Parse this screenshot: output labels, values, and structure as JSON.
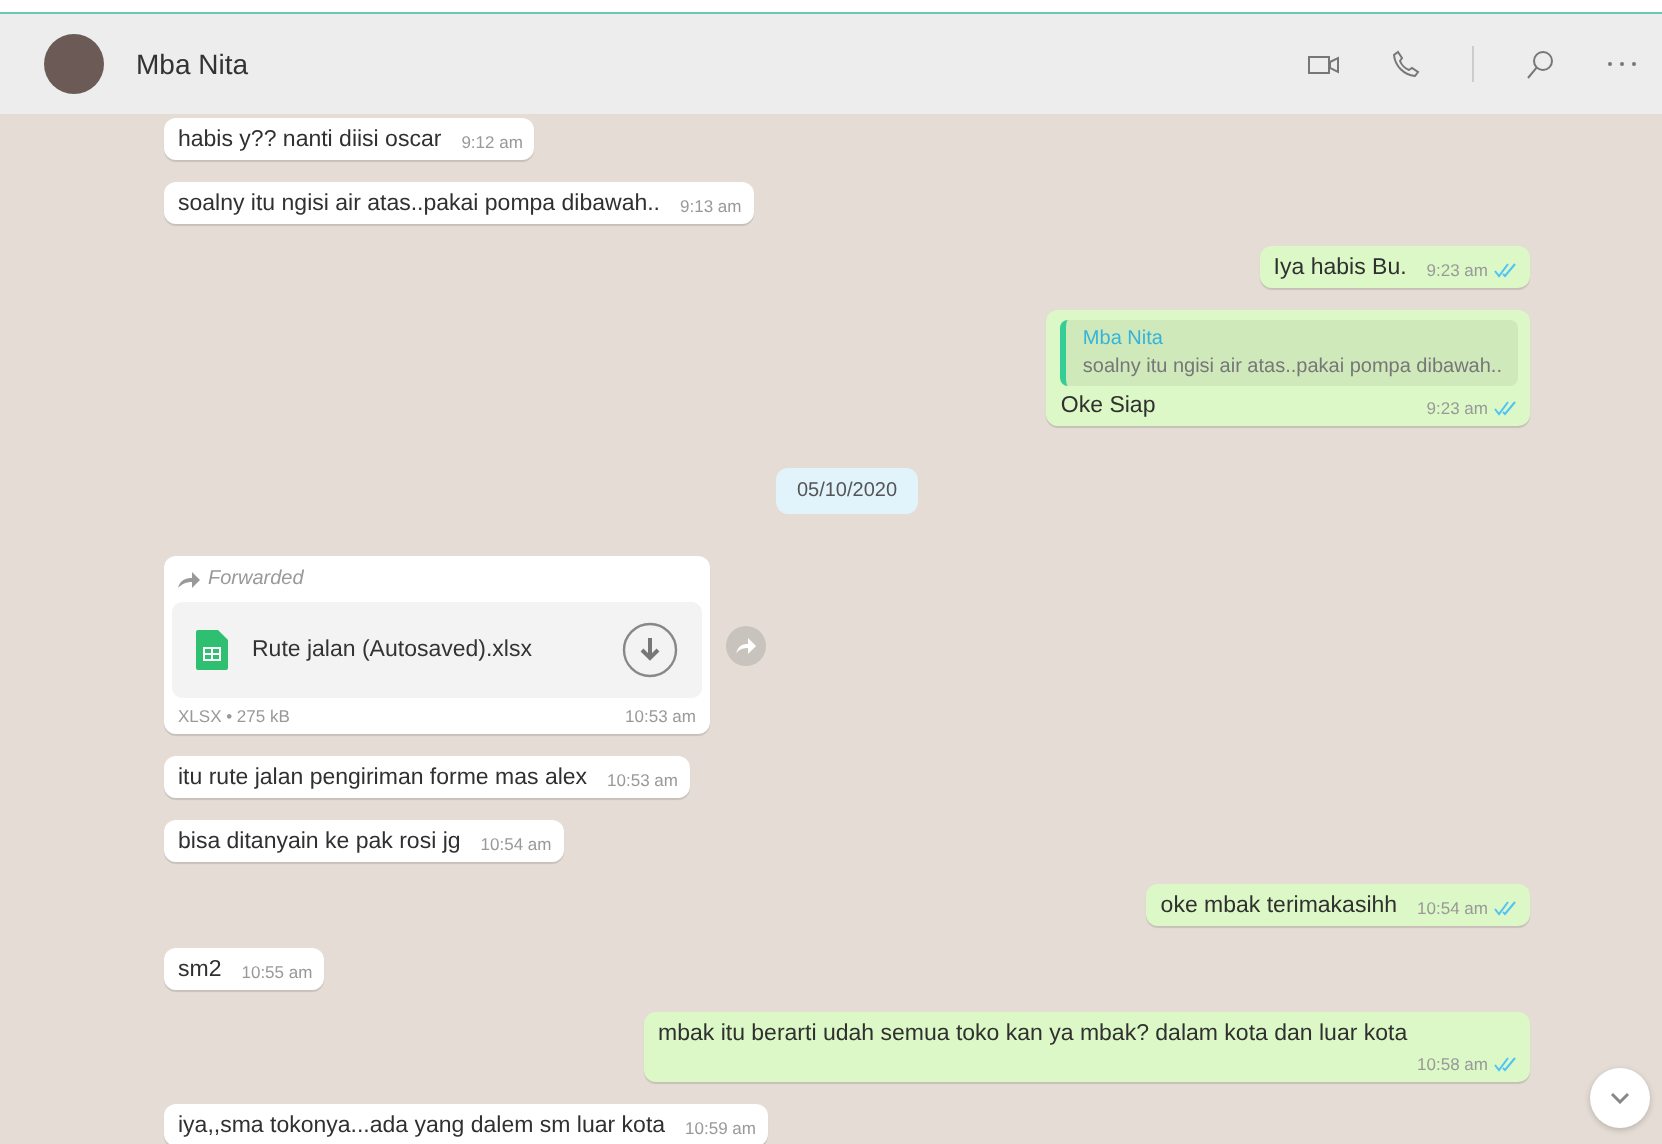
{
  "header": {
    "contact_name": "Mba Nita"
  },
  "messages": [
    {
      "kind": "text",
      "outgoing": false,
      "text": "habis y?? nanti diisi oscar",
      "time": "9:12 am"
    },
    {
      "kind": "text",
      "outgoing": false,
      "text": "soalny itu ngisi air atas..pakai pompa dibawah..",
      "time": "9:13 am"
    },
    {
      "kind": "text",
      "outgoing": true,
      "text": "Iya habis Bu.",
      "time": "9:23 am",
      "read": true
    },
    {
      "kind": "quote",
      "outgoing": true,
      "quote_author": "Mba Nita",
      "quote_text": "soalny itu ngisi air atas..pakai pompa dibawah..",
      "text": "Oke Siap",
      "time": "9:23 am",
      "read": true
    },
    {
      "kind": "date",
      "text": "05/10/2020"
    },
    {
      "kind": "file",
      "outgoing": false,
      "forwarded_label": "Forwarded",
      "file_name": "Rute jalan (Autosaved).xlsx",
      "file_info": "XLSX • 275 kB",
      "time": "10:53 am"
    },
    {
      "kind": "text",
      "outgoing": false,
      "text": "itu rute jalan pengiriman forme mas alex",
      "time": "10:53 am"
    },
    {
      "kind": "text",
      "outgoing": false,
      "text": "bisa ditanyain ke pak rosi jg",
      "time": "10:54 am"
    },
    {
      "kind": "text",
      "outgoing": true,
      "text": "oke mbak terimakasihh",
      "time": "10:54 am",
      "read": true
    },
    {
      "kind": "text",
      "outgoing": false,
      "text": "sm2",
      "time": "10:55 am"
    },
    {
      "kind": "text",
      "outgoing": true,
      "text": "mbak itu berarti udah semua toko kan ya mbak? dalam kota dan luar kota",
      "time": "10:58 am",
      "read": true
    },
    {
      "kind": "text",
      "outgoing": false,
      "text": "iya,,sma tokonya...ada yang dalem sm luar kota",
      "time": "10:59 am"
    }
  ]
}
